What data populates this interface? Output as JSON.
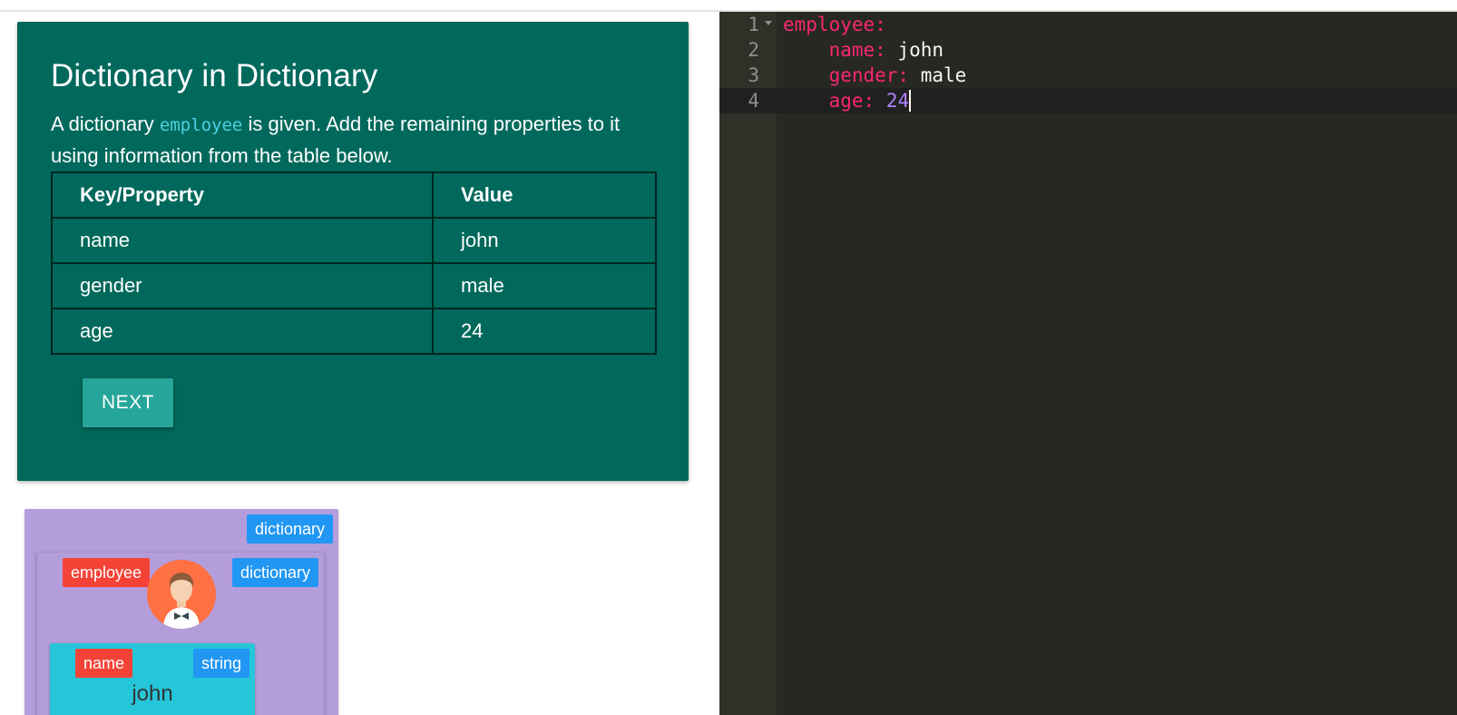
{
  "task": {
    "title": "Dictionary in Dictionary",
    "desc_prefix": "A dictionary ",
    "desc_code": "employee",
    "desc_suffix": " is given. Add the remaining properties to it using information from the table below.",
    "table": {
      "headers": [
        "Key/Property",
        "Value"
      ],
      "rows": [
        [
          "name",
          "john"
        ],
        [
          "gender",
          "male"
        ],
        [
          "age",
          "24"
        ]
      ]
    },
    "next_label": "NEXT"
  },
  "visualization": {
    "outer_type": "dictionary",
    "employee_key": "employee",
    "employee_type": "dictionary",
    "avatar_icon": "person-avatar-icon",
    "field_key": "name",
    "field_type": "string",
    "field_value": "john"
  },
  "editor": {
    "line_numbers": [
      "1",
      "2",
      "3",
      "4"
    ],
    "lines": [
      {
        "indent": "",
        "key": "employee:",
        "value": ""
      },
      {
        "indent": "    ",
        "key": "name:",
        "value": " john"
      },
      {
        "indent": "    ",
        "key": "gender:",
        "value": " male"
      },
      {
        "indent": "    ",
        "key": "age:",
        "value": " 24"
      }
    ]
  },
  "colors": {
    "card_bg": "#00695c",
    "button_bg": "#26a69a",
    "viz_bg": "#b39ddb",
    "chip_blue": "#2196f3",
    "chip_red": "#f44336",
    "editor_bg": "#272822",
    "yaml_key": "#f92672",
    "yaml_number": "#ae81ff"
  }
}
